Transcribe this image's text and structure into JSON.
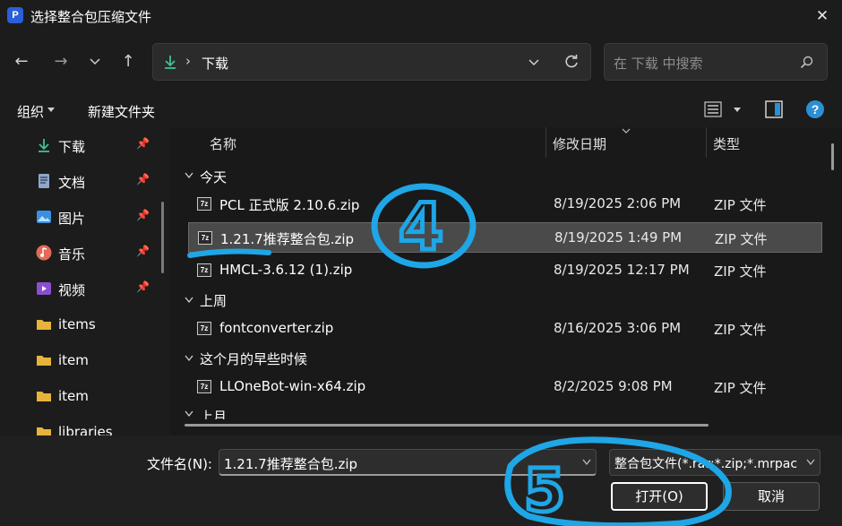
{
  "window": {
    "title": "选择整合包压缩文件",
    "app_icon": "P"
  },
  "nav": {
    "address_location": "下载",
    "search_placeholder": "在 下载 中搜索"
  },
  "toolbar": {
    "organize_label": "组织",
    "new_folder_label": "新建文件夹"
  },
  "sidebar": {
    "items": [
      {
        "label": "下载",
        "icon": "download-icon",
        "pinned": true
      },
      {
        "label": "文档",
        "icon": "document-icon",
        "pinned": true
      },
      {
        "label": "图片",
        "icon": "picture-icon",
        "pinned": true
      },
      {
        "label": "音乐",
        "icon": "music-icon",
        "pinned": true
      },
      {
        "label": "视频",
        "icon": "video-icon",
        "pinned": true
      },
      {
        "label": "items",
        "icon": "folder-icon",
        "pinned": false
      },
      {
        "label": "item",
        "icon": "folder-icon",
        "pinned": false
      },
      {
        "label": "item",
        "icon": "folder-icon",
        "pinned": false
      },
      {
        "label": "libraries",
        "icon": "folder-icon",
        "pinned": false
      }
    ]
  },
  "columns": {
    "name": "名称",
    "date": "修改日期",
    "type": "类型"
  },
  "groups": [
    {
      "label": "今天",
      "files": [
        {
          "name": "PCL 正式版 2.10.6.zip",
          "date": "8/19/2025 2:06 PM",
          "type": "ZIP 文件",
          "selected": false
        },
        {
          "name": "1.21.7推荐整合包.zip",
          "date": "8/19/2025 1:49 PM",
          "type": "ZIP 文件",
          "selected": true
        },
        {
          "name": "HMCL-3.6.12 (1).zip",
          "date": "8/19/2025 12:17 PM",
          "type": "ZIP 文件",
          "selected": false
        }
      ]
    },
    {
      "label": "上周",
      "files": [
        {
          "name": "fontconverter.zip",
          "date": "8/16/2025 3:06 PM",
          "type": "ZIP 文件",
          "selected": false
        }
      ]
    },
    {
      "label": "这个月的早些时候",
      "files": [
        {
          "name": "LLOneBot-win-x64.zip",
          "date": "8/2/2025 9:08 PM",
          "type": "ZIP 文件",
          "selected": false
        }
      ]
    },
    {
      "label": "上月",
      "files": []
    }
  ],
  "zip_icon_text": "7z",
  "footer": {
    "filename_label": "文件名(N):",
    "filename_value": "1.21.7推荐整合包.zip",
    "filetype_value": "整合包文件(*.rar;*.zip;*.mrpac",
    "open_label": "打开(O)",
    "cancel_label": "取消"
  },
  "annotations": {
    "step_a": "4",
    "step_b": "5",
    "color": "#1fa6e6"
  },
  "colors": {
    "background": "#1c1c1c",
    "selection": "#4a4a4a",
    "accent": "#2b8fd6",
    "folder": "#e8b33a"
  }
}
